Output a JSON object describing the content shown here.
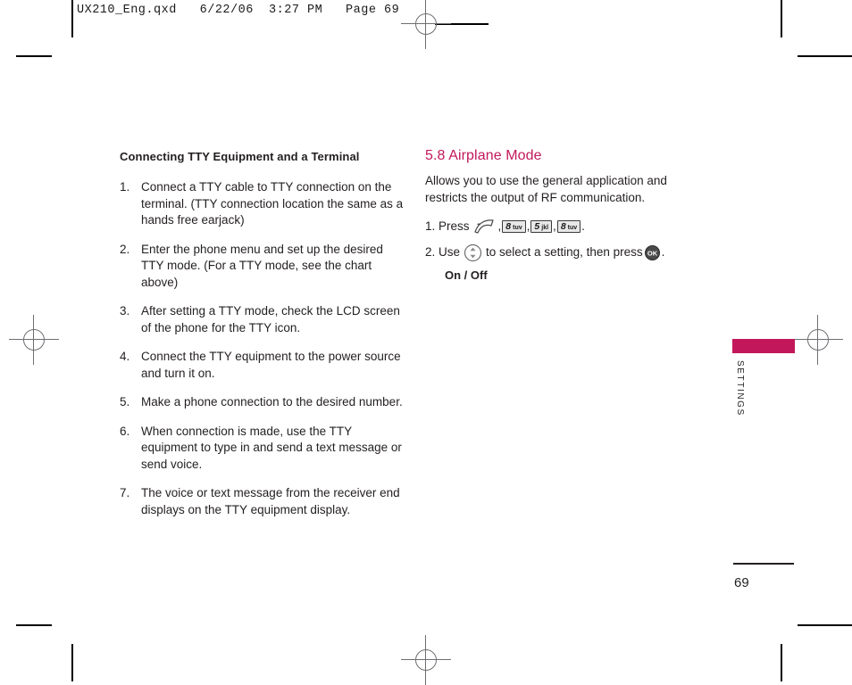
{
  "prepress": {
    "slug": "UX210_Eng.qxd   6/22/06  3:27 PM   Page 69"
  },
  "left_column": {
    "subhead": "Connecting TTY Equipment and a Terminal",
    "steps": [
      {
        "num": "1.",
        "text": "Connect a TTY cable to TTY connection on the terminal. (TTY connection location the same as a hands free earjack)"
      },
      {
        "num": "2.",
        "text": "Enter the phone menu and set up the desired TTY mode. (For a TTY mode, see the chart above)"
      },
      {
        "num": "3.",
        "text": "After setting a TTY mode, check the LCD screen of the phone for the TTY icon."
      },
      {
        "num": "4.",
        "text": "Connect the TTY equipment to the power source and turn it on."
      },
      {
        "num": "5.",
        "text": "Make a phone connection to the desired number."
      },
      {
        "num": "6.",
        "text": "When connection is made, use the TTY equipment to type in and send a text message or send voice."
      },
      {
        "num": "7.",
        "text": "The voice or text message from the receiver end displays on the TTY equipment display."
      }
    ]
  },
  "right_column": {
    "section_heading": "5.8 Airplane Mode",
    "intro": "Allows you to use the general application and restricts the output of RF communication.",
    "step1": {
      "prefix": "1. Press",
      "comma1": ",",
      "comma2": ",",
      "comma3": ",",
      "period": ".",
      "keys": [
        {
          "digit": "8",
          "letters": "tuv"
        },
        {
          "digit": "5",
          "letters": "jkl"
        },
        {
          "digit": "8",
          "letters": "tuv"
        }
      ],
      "send_key_name": "send-key"
    },
    "step2": {
      "prefix": "2. Use",
      "middle": "to select a setting, then press",
      "period": ".",
      "ok_label": "OK"
    },
    "options": "On / Off"
  },
  "side_tab": {
    "label": "SETTINGS",
    "color": "#c2185b"
  },
  "folio": {
    "page_number": "69"
  },
  "colors": {
    "accent": "#c2185b",
    "text": "#231f20"
  }
}
